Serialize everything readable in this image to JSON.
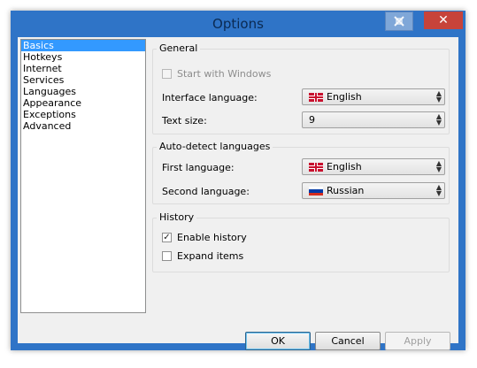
{
  "window": {
    "title": "Options",
    "accent": "#2f74c7",
    "close_glyph": "✕",
    "pin_icon": "pin-icon"
  },
  "nav": {
    "items": [
      {
        "label": "Basics",
        "selected": true
      },
      {
        "label": "Hotkeys"
      },
      {
        "label": "Internet"
      },
      {
        "label": "Services"
      },
      {
        "label": "Languages"
      },
      {
        "label": "Appearance"
      },
      {
        "label": "Exceptions"
      },
      {
        "label": "Advanced"
      }
    ]
  },
  "general": {
    "title": "General",
    "start_with_windows": "Start with Windows",
    "interface_language_label": "Interface language:",
    "interface_language_value": "English",
    "text_size_label": "Text size:",
    "text_size_value": "9"
  },
  "autodetect": {
    "title": "Auto-detect languages",
    "first_label": "First language:",
    "first_value": "English",
    "second_label": "Second language:",
    "second_value": "Russian"
  },
  "history": {
    "title": "History",
    "enable_history": "Enable history",
    "enable_checked": true,
    "expand_items": "Expand items"
  },
  "buttons": {
    "ok": "OK",
    "cancel": "Cancel",
    "apply": "Apply"
  },
  "icons": {
    "uk_flag": "uk-flag-icon",
    "ru_flag": "russia-flag-icon",
    "dropdown": "updown-arrow-icon",
    "checkmark": "✓"
  }
}
